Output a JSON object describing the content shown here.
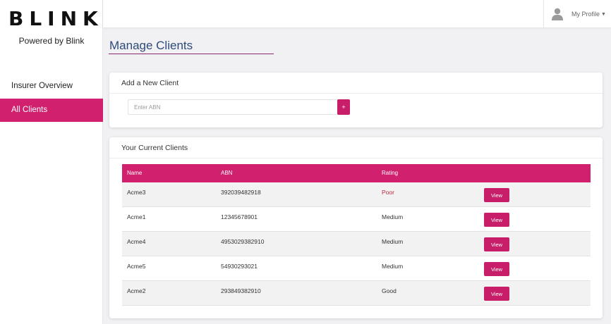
{
  "brand": {
    "logo_text": "BLINK",
    "powered_by": "Powered by Blink"
  },
  "sidebar": {
    "items": [
      {
        "label": "Insurer Overview",
        "active": false
      },
      {
        "label": "All Clients",
        "active": true
      }
    ]
  },
  "header": {
    "profile_label": "My Profile",
    "profile_icon": "user-icon"
  },
  "page": {
    "title": "Manage Clients"
  },
  "add_client": {
    "heading": "Add a New Client",
    "abn_placeholder": "Enter ABN",
    "abn_value": "",
    "add_button_label": "+"
  },
  "clients": {
    "heading": "Your Current Clients",
    "columns": [
      "Name",
      "ABN",
      "Rating"
    ],
    "rows": [
      {
        "name": "Acme3",
        "abn": "392039482918",
        "rating": "Poor",
        "action": "View"
      },
      {
        "name": "Acme1",
        "abn": "12345678901",
        "rating": "Medium",
        "action": "View"
      },
      {
        "name": "Acme4",
        "abn": "4953029382910",
        "rating": "Medium",
        "action": "View"
      },
      {
        "name": "Acme5",
        "abn": "54930293021",
        "rating": "Medium",
        "action": "View"
      },
      {
        "name": "Acme2",
        "abn": "293849382910",
        "rating": "Good",
        "action": "View"
      }
    ]
  },
  "colors": {
    "accent": "#d0206e",
    "rating_poor": "#c0283d",
    "title": "#2e4a7a"
  }
}
